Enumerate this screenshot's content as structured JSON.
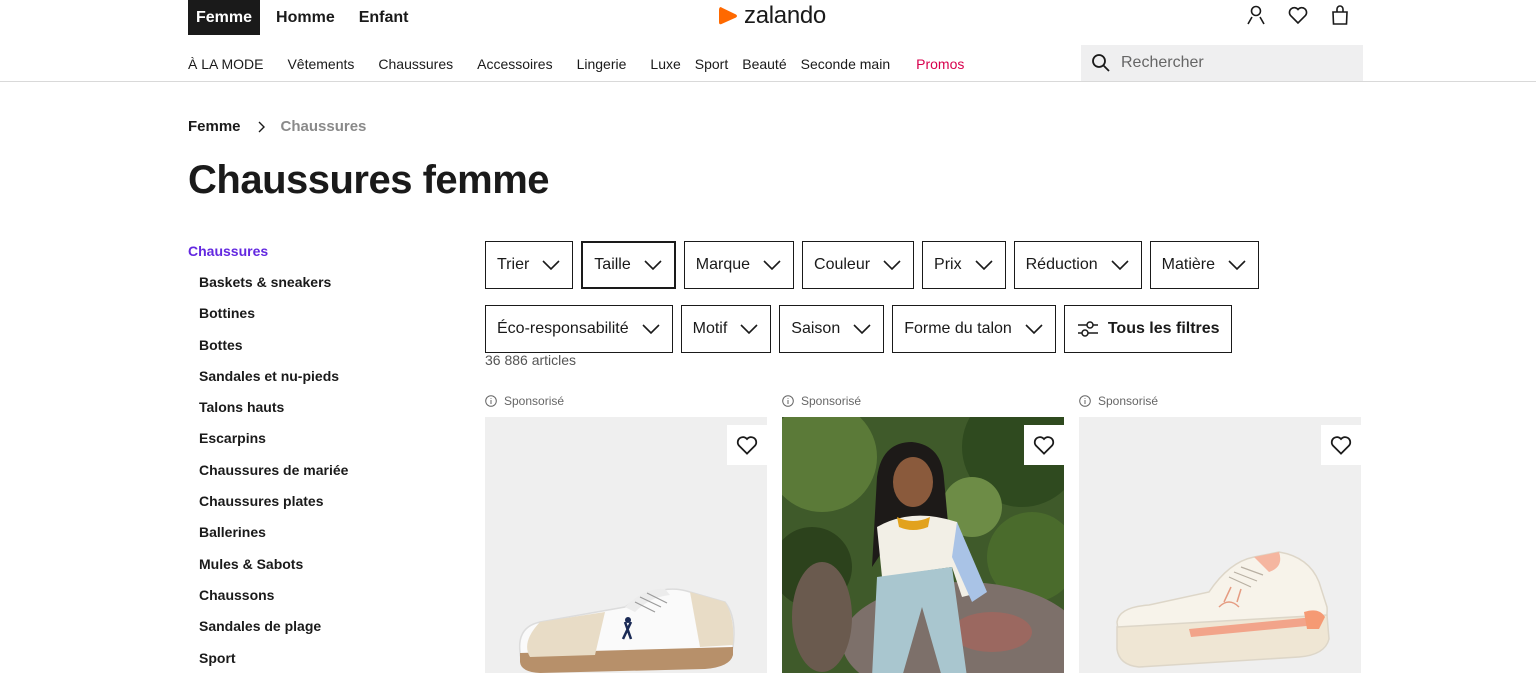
{
  "header": {
    "gender_tabs": [
      "Femme",
      "Homme",
      "Enfant"
    ],
    "logo_text": "zalando",
    "brand_color": "#ff6900",
    "icons": [
      "user-icon",
      "heart-icon",
      "bag-icon"
    ]
  },
  "nav": {
    "items": [
      "À LA MODE",
      "Vêtements",
      "Chaussures",
      "Accessoires",
      "Lingerie",
      "Luxe",
      "Sport",
      "Beauté",
      "Seconde main",
      "Promos"
    ],
    "promo_color": "#d8004d"
  },
  "search": {
    "placeholder": "Rechercher"
  },
  "breadcrumb": [
    "Femme",
    "Chaussures"
  ],
  "page_title": "Chaussures femme",
  "sidebar": {
    "heading": "Chaussures",
    "heading_color": "#6328e0",
    "items": [
      "Baskets & sneakers",
      "Bottines",
      "Bottes",
      "Sandales et nu-pieds",
      "Talons hauts",
      "Escarpins",
      "Chaussures de mariée",
      "Chaussures plates",
      "Ballerines",
      "Mules & Sabots",
      "Chaussons",
      "Sandales de plage",
      "Sport"
    ]
  },
  "filters": {
    "row1": [
      "Trier",
      "Taille",
      "Marque",
      "Couleur",
      "Prix",
      "Réduction",
      "Matière"
    ],
    "row2": [
      "Éco-responsabilité",
      "Motif",
      "Saison",
      "Forme du talon"
    ],
    "all_filters": "Tous les filtres",
    "active": "Taille"
  },
  "article_count": "36 886 articles",
  "products": [
    {
      "label": "Sponsorisé",
      "image": "white-sneaker-navy-logo"
    },
    {
      "label": "Sponsorisé",
      "image": "model-sitting-on-rock"
    },
    {
      "label": "Sponsorisé",
      "image": "platform-sneaker-peach-stripes"
    }
  ]
}
